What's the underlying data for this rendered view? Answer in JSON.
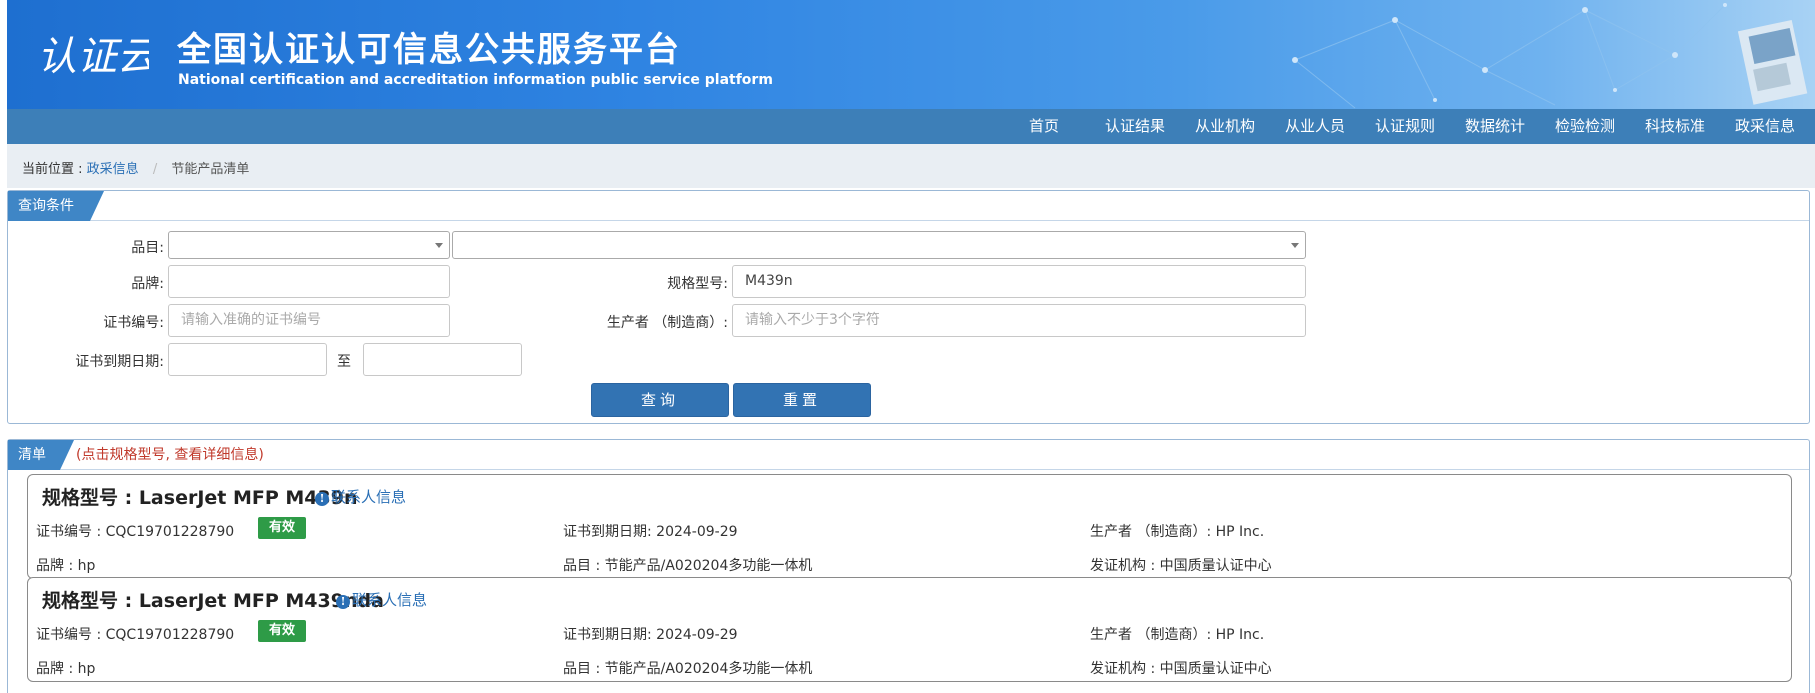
{
  "header": {
    "logo_text": "认证云",
    "title": "全国认证认可信息公共服务平台",
    "subtitle": "National certification and accreditation information public service platform"
  },
  "nav": {
    "items": [
      "首页",
      "认证结果",
      "从业机构",
      "从业人员",
      "认证规则",
      "数据统计",
      "检验检测",
      "科技标准",
      "政采信息"
    ]
  },
  "breadcrumb": {
    "prefix": "当前位置 :",
    "parent": "政采信息",
    "separator": "/",
    "current": "节能产品清单"
  },
  "query": {
    "panel_title": "查询条件",
    "category_label": "品目:",
    "category_value": "",
    "subcategory_value": "",
    "brand_label": "品牌:",
    "brand_value": "",
    "model_label": "规格型号:",
    "model_value": "M439n",
    "cert_no_label": "证书编号:",
    "cert_no_placeholder": "请输入准确的证书编号",
    "manufacturer_label": "生产者 （制造商）:",
    "manufacturer_placeholder": "请输入不少于3个字符",
    "expiry_label": "证书到期日期:",
    "expiry_from": "",
    "expiry_to_label": "至",
    "expiry_to": "",
    "search_button": "查询",
    "reset_button": "重置"
  },
  "list": {
    "panel_title": "清单",
    "hint": "(点击规格型号, 查看详细信息)",
    "contact_label": "联系人信息",
    "cert_no_label": "证书编号 :",
    "expiry_label": "证书到期日期:",
    "manufacturer_label": "生产者 （制造商）:",
    "brand_label": "品牌 :",
    "category_label": "品目 :",
    "issuer_label": "发证机构 :",
    "items": [
      {
        "title": "规格型号 : LaserJet MFP M439n",
        "cert_no": "CQC19701228790",
        "status": "有效",
        "expiry": "2024-09-29",
        "manufacturer": "HP Inc.",
        "brand": "hp",
        "category": "节能产品/A020204多功能一体机",
        "issuer": "中国质量认证中心"
      },
      {
        "title": "规格型号 : LaserJet MFP M439nda",
        "cert_no": "CQC19701228790",
        "status": "有效",
        "expiry": "2024-09-29",
        "manufacturer": "HP Inc.",
        "brand": "hp",
        "category": "节能产品/A020204多功能一体机",
        "issuer": "中国质量认证中心"
      }
    ]
  },
  "colors": {
    "nav_bg": "#3d7fb8",
    "tab_bg": "#3f86c6",
    "button_bg": "#3273b3",
    "badge_valid": "#2e9b47",
    "link": "#2a6fb5",
    "hint_red": "#c0392b"
  }
}
